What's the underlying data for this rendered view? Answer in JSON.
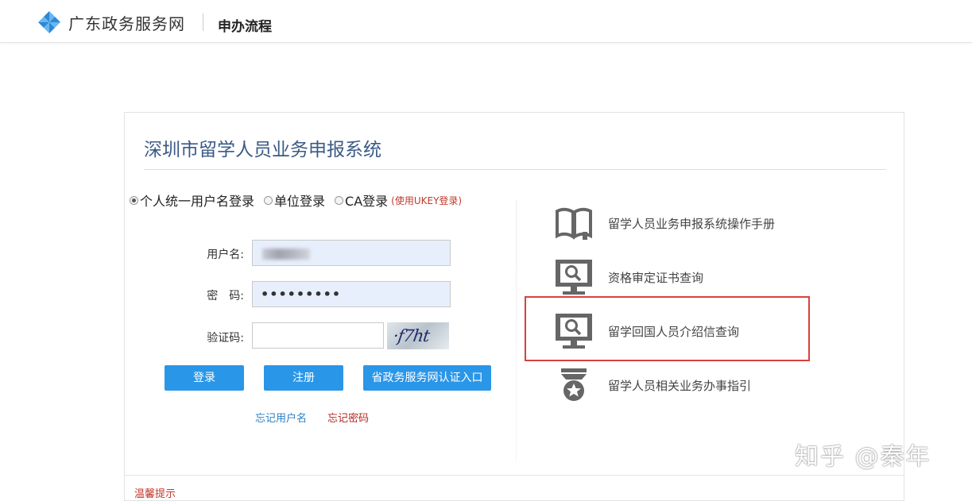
{
  "header": {
    "site_name": "广东政务服务网",
    "section": "申办流程",
    "logo_icon": "pinwheel-logo-icon",
    "accent": "#2a88d8"
  },
  "system": {
    "title": "深圳市留学人员业务申报系统"
  },
  "login": {
    "types": [
      {
        "label": "个人统一用户名登录",
        "checked": true
      },
      {
        "label": "单位登录",
        "checked": false
      },
      {
        "label": "CA登录",
        "checked": false
      }
    ],
    "ca_note": "(使用UKEY登录)",
    "username_label": "用户名:",
    "password_label": "密　码:",
    "password_value": "•••••••••",
    "captcha_label": "验证码:",
    "captcha_text": "·f7ht",
    "captcha_value": "",
    "buttons": {
      "login": "登录",
      "register": "注册",
      "portal": "省政务服务网认证入口"
    },
    "forgot_username": "忘记用户名",
    "forgot_password": "忘记密码",
    "button_color": "#2a96e8"
  },
  "services": [
    {
      "label": "留学人员业务申报系统操作手册",
      "icon": "open-book-icon"
    },
    {
      "label": "资格审定证书查询",
      "icon": "monitor-search-icon"
    },
    {
      "label": "留学回国人员介绍信查询",
      "icon": "monitor-search-icon",
      "highlighted": true
    },
    {
      "label": "留学人员相关业务办事指引",
      "icon": "star-badge-icon"
    }
  ],
  "tip": "温馨提示",
  "watermark": "知乎 @秦年"
}
